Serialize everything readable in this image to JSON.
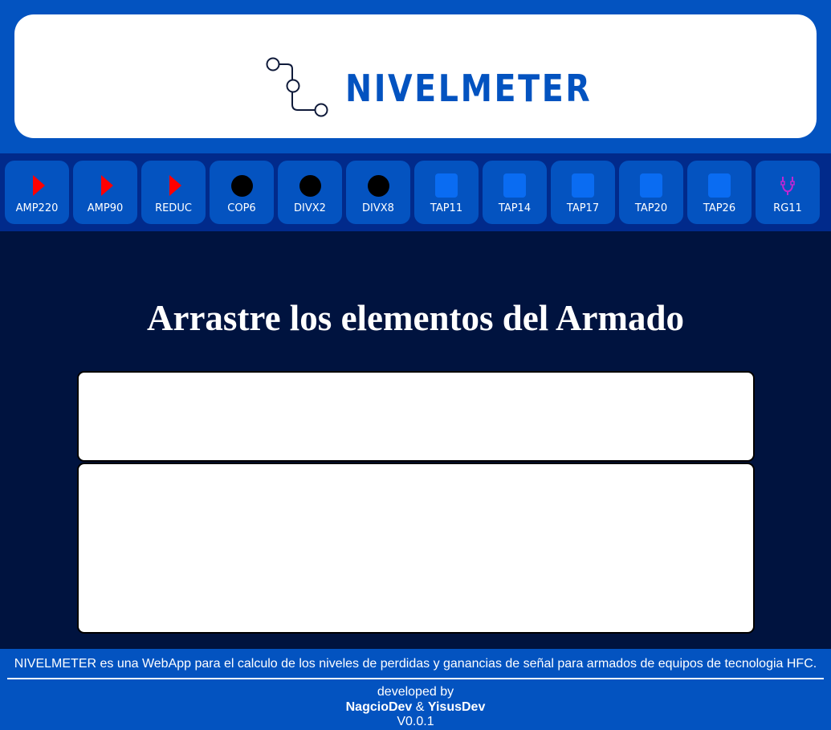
{
  "brand": {
    "name": "NIVELMETER",
    "logo_icon": "network-path-icon",
    "color": "#0353c0"
  },
  "toolbar": {
    "items": [
      {
        "label": "AMP220",
        "icon": "red-triangle-icon"
      },
      {
        "label": "AMP90",
        "icon": "red-triangle-icon"
      },
      {
        "label": "REDUC",
        "icon": "red-triangle-icon"
      },
      {
        "label": "COP6",
        "icon": "black-circle-icon"
      },
      {
        "label": "DIVX2",
        "icon": "black-circle-icon"
      },
      {
        "label": "DIVX8",
        "icon": "black-circle-icon"
      },
      {
        "label": "TAP11",
        "icon": "blue-square-icon"
      },
      {
        "label": "TAP14",
        "icon": "blue-square-icon"
      },
      {
        "label": "TAP17",
        "icon": "blue-square-icon"
      },
      {
        "label": "TAP20",
        "icon": "blue-square-icon"
      },
      {
        "label": "TAP26",
        "icon": "blue-square-icon"
      },
      {
        "label": "RG11",
        "icon": "coax-cable-icon"
      }
    ]
  },
  "main": {
    "title": "Arrastre los elementos del Armado"
  },
  "footer": {
    "description": "NIVELMETER es una WebApp para el calculo de los niveles de perdidas y ganancias de señal para armados de equipos de tecnologia HFC.",
    "developed_by": "developed by",
    "dev1": "NagcioDev",
    "separator": "&",
    "dev2": "YisusDev",
    "version": "V0.0.1"
  },
  "colors": {
    "header_bg": "#0353c0",
    "toolbar_bg": "#012a8b",
    "page_bg": "#00133f",
    "amp_red": "#ff0000",
    "tap_blue": "#0a6cf2",
    "rg11_purple": "#c026d3"
  }
}
